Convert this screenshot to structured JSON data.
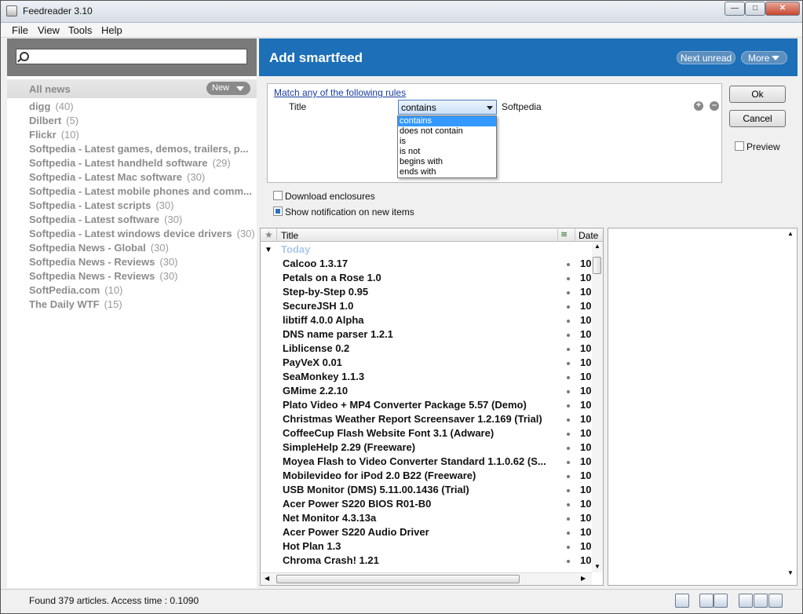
{
  "window": {
    "title": "Feedreader 3.10"
  },
  "menu": [
    "File",
    "View",
    "Tools",
    "Help"
  ],
  "search": {
    "placeholder": ""
  },
  "sidebar": {
    "all_news_label": "All news",
    "new_button": "New",
    "feeds": [
      {
        "name": "digg",
        "count": "(40)"
      },
      {
        "name": "Dilbert",
        "count": "(5)"
      },
      {
        "name": "Flickr",
        "count": "(10)"
      },
      {
        "name": "Softpedia - Latest games, demos, trailers, p...",
        "count": ""
      },
      {
        "name": "Softpedia - Latest handheld software",
        "count": "(29)"
      },
      {
        "name": "Softpedia - Latest Mac software",
        "count": "(30)"
      },
      {
        "name": "Softpedia - Latest mobile phones and comm...",
        "count": ""
      },
      {
        "name": "Softpedia - Latest scripts",
        "count": "(30)"
      },
      {
        "name": "Softpedia - Latest software",
        "count": "(30)"
      },
      {
        "name": "Softpedia - Latest windows device drivers",
        "count": "(30)"
      },
      {
        "name": "Softpedia News - Global",
        "count": "(30)"
      },
      {
        "name": "Softpedia News - Reviews",
        "count": "(30)"
      },
      {
        "name": "Softpedia News - Reviews",
        "count": "(30)"
      },
      {
        "name": "SoftPedia.com",
        "count": "(10)"
      },
      {
        "name": "The Daily WTF",
        "count": "(15)"
      }
    ]
  },
  "header": {
    "title": "Add smartfeed",
    "next_unread": "Next unread",
    "more": "More"
  },
  "rules": {
    "match_link": "Match any of the following rules",
    "field": "Title",
    "operator": "contains",
    "value": "Softpedia",
    "add_icon": "plus-icon",
    "remove_icon": "minus-icon",
    "dropdown_options": [
      "contains",
      "does not contain",
      "is",
      "is not",
      "begins with",
      "ends with"
    ],
    "dropdown_selected": "contains"
  },
  "dialog_buttons": {
    "ok": "Ok",
    "cancel": "Cancel",
    "preview": "Preview"
  },
  "options": {
    "download_enclosures": "Download enclosures",
    "show_notification": "Show notification on new items",
    "download_enclosures_checked": false,
    "show_notification_checked": true
  },
  "list": {
    "col_title": "Title",
    "col_date": "Date",
    "group_label": "Today",
    "date_value": "10",
    "items": [
      "Calcoo 1.3.17",
      "Petals on a Rose 1.0",
      "Step-by-Step 0.95",
      "SecureJSH 1.0",
      "libtiff 4.0.0 Alpha",
      "DNS name parser 1.2.1",
      "Liblicense 0.2",
      "PayVeX 0.01",
      "SeaMonkey 1.1.3",
      "GMime 2.2.10",
      "Plato Video + MP4 Converter Package 5.57 (Demo)",
      "Christmas Weather Report Screensaver 1.2.169 (Trial)",
      "CoffeeCup Flash Website Font 3.1 (Adware)",
      "SimpleHelp 2.29 (Freeware)",
      "Moyea Flash to Video Converter Standard 1.1.0.62 (S...",
      "Mobilevideo for iPod 2.0 B22 (Freeware)",
      "USB Monitor (DMS) 5.11.00.1436 (Trial)",
      "Acer Power S220 BIOS R01-B0",
      "Net Monitor 4.3.13a",
      "Acer Power S220 Audio Driver",
      "Hot Plan 1.3",
      "Chroma Crash! 1.21"
    ]
  },
  "status": {
    "text": "Found 379 articles. Access time : 0.1090"
  },
  "colors": {
    "header_blue": "#1d6fb8",
    "feed_gray": "#8c8c8c",
    "selection_blue": "#3399ff"
  }
}
